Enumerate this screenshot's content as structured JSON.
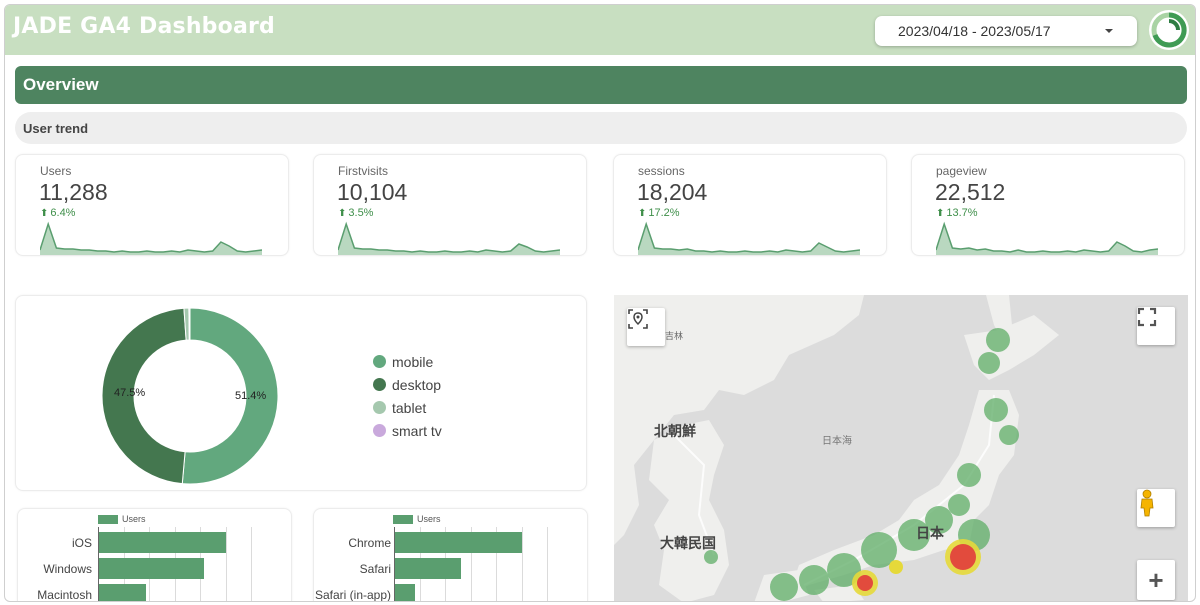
{
  "header": {
    "title": "JADE GA4 Dashboard",
    "date_range": "2023/04/18 - 2023/05/17",
    "logo_icon": "ring-logo-icon",
    "dropdown_icon": "caret-down-icon"
  },
  "sections": {
    "overview": "Overview",
    "user_trend": "User trend"
  },
  "kpis": [
    {
      "label": "Users",
      "value": "11,288",
      "delta": "6.4%",
      "trend": [
        4,
        30,
        6,
        5,
        5,
        4,
        4,
        3,
        3,
        2,
        3,
        2,
        2,
        3,
        2,
        2,
        3,
        2,
        4,
        3,
        2,
        3,
        12,
        8,
        3,
        2,
        3,
        4
      ]
    },
    {
      "label": "Firstvisits",
      "value": "10,104",
      "delta": "3.5%",
      "trend": [
        4,
        30,
        6,
        5,
        5,
        4,
        4,
        3,
        3,
        2,
        3,
        2,
        2,
        3,
        2,
        2,
        3,
        2,
        4,
        3,
        2,
        3,
        10,
        7,
        3,
        2,
        3,
        4
      ]
    },
    {
      "label": "sessions",
      "value": "18,204",
      "delta": "17.2%",
      "trend": [
        4,
        30,
        6,
        5,
        5,
        4,
        5,
        3,
        3,
        2,
        3,
        2,
        2,
        3,
        2,
        2,
        3,
        2,
        4,
        3,
        2,
        3,
        11,
        7,
        3,
        2,
        3,
        4
      ]
    },
    {
      "label": "pageview",
      "value": "22,512",
      "delta": "13.7%",
      "trend": [
        4,
        30,
        6,
        5,
        6,
        4,
        5,
        3,
        3,
        2,
        4,
        2,
        2,
        3,
        2,
        2,
        3,
        2,
        4,
        3,
        2,
        3,
        12,
        8,
        3,
        2,
        4,
        5
      ]
    }
  ],
  "device_chart": {
    "slices": [
      {
        "name": "mobile",
        "value": 51.4,
        "label": "51.4%",
        "color": "#62a87e"
      },
      {
        "name": "desktop",
        "value": 47.5,
        "label": "47.5%",
        "color": "#44774f"
      },
      {
        "name": "tablet",
        "value": 0.9,
        "label": "",
        "color": "#a5c8ae"
      },
      {
        "name": "smart tv",
        "value": 0.2,
        "label": "",
        "color": "#c9a9dc"
      }
    ]
  },
  "os_chart": {
    "legend": "Users",
    "categories": [
      "iOS",
      "Windows",
      "Macintosh"
    ],
    "values": [
      100,
      83,
      37
    ]
  },
  "browser_chart": {
    "legend": "Users",
    "categories": [
      "Chrome",
      "Safari",
      "Safari (in-app)"
    ],
    "values": [
      100,
      52,
      16
    ]
  },
  "map": {
    "labels": {
      "nk": "北朝鮮",
      "sk": "大韓民国",
      "jp": "日本",
      "sea": "日本海",
      "jilin": "吉林"
    },
    "controls": {
      "locate_icon": "map-pin-icon",
      "fullscreen_icon": "fullscreen-icon",
      "pegman_icon": "street-view-pegman-icon",
      "zoom_in_label": "+"
    },
    "colors": {
      "land": "#ededeb",
      "heat_low": "#5fae67",
      "heat_mid": "#e5d93a",
      "heat_high": "#e24b3d"
    }
  }
}
